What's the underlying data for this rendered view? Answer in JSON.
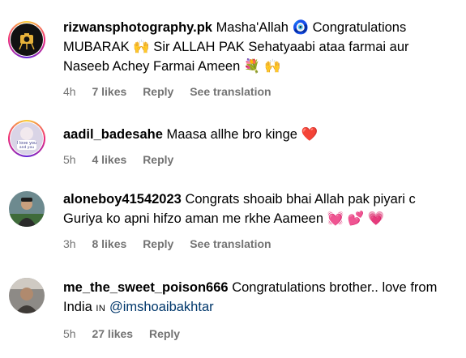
{
  "comments": [
    {
      "username": "rizwansphotography.pk",
      "text": "Masha'Allah 🧿 Congratulations MUBARAK 🙌 Sir ALLAH PAK Sehatyaabi ataa farmai aur Naseeb Achey Farmai Ameen 💐 🙌",
      "time": "4h",
      "likes": "7 likes",
      "reply": "Reply",
      "translate": "See translation",
      "avatar_icon": "camera-logo-avatar",
      "has_story_ring": true
    },
    {
      "username": "aadil_badesahe",
      "text": "Maasa allhe bro kinge ❤️",
      "time": "5h",
      "likes": "4 likes",
      "reply": "Reply",
      "avatar_icon": "i-love-you-photo-avatar",
      "has_story_ring": true
    },
    {
      "username": "aloneboy41542023",
      "text": "Congrats shoaib bhai Allah pak piyari c Guriya ko apni hifzo aman me rkhe Aameen 💓 💕 💗",
      "time": "3h",
      "likes": "8 likes",
      "reply": "Reply",
      "translate": "See translation",
      "avatar_icon": "person-photo-avatar",
      "has_story_ring": false
    },
    {
      "username": "me_the_sweet_poison666",
      "text_before": "Congratulations brother.. love from India",
      "tag": "IN",
      "mention": "@imshoaibakhtar",
      "time": "5h",
      "likes": "27 likes",
      "reply": "Reply",
      "avatar_icon": "person-photo-avatar",
      "has_story_ring": false
    }
  ],
  "colors": {
    "meta_text": "#737373",
    "mention": "#00376b",
    "heart_red": "#ff3040"
  }
}
